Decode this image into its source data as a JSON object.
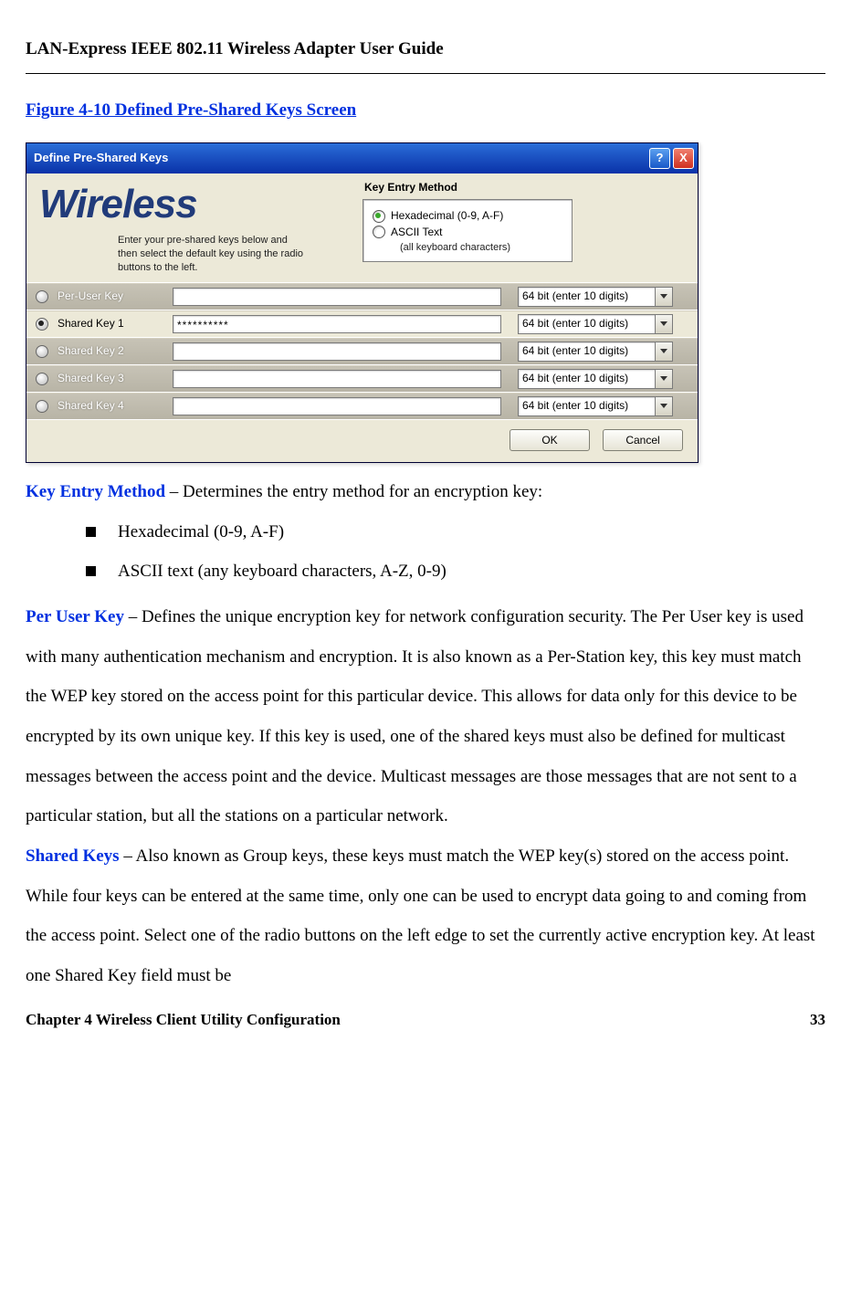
{
  "doc": {
    "header_title": "LAN-Express IEEE 802.11 Wireless Adapter User Guide",
    "figure_caption": "Figure 4-10 Defined Pre-Shared Keys Screen",
    "kem_term": "Key Entry Method",
    "kem_desc": " – Determines the entry method for an encryption key:",
    "bullet_hex": "Hexadecimal (0-9, A-F)",
    "bullet_ascii": "ASCII text (any keyboard characters, A-Z, 0-9)",
    "puk_term": "Per User Key",
    "puk_desc": " – Defines the unique encryption key for network configuration security. The Per User key is used with many authentication mechanism and encryption. It is also known as a Per-Station key, this key must match the WEP key stored on the access point for this particular device.  This allows for data only for this device to be encrypted by its own unique key.  If this key is used, one of the shared keys must also be defined for multicast messages between the access point and the device.  Multicast messages are those messages that are not sent to a particular station, but all the stations on a particular network.",
    "sk_term": "Shared Keys",
    "sk_desc": " – Also known as Group keys, these keys must match the WEP key(s) stored on the access point. While four keys can be entered at the same time, only one can be used to encrypt data going to and coming from the access point. Select one of the radio buttons on the left edge to set the currently active encryption key. At least one Shared Key field must be",
    "footer_left": "Chapter 4 Wireless Client Utility Configuration",
    "footer_right": "33"
  },
  "dialog": {
    "title": "Define Pre-Shared Keys",
    "help_glyph": "?",
    "close_glyph": "X",
    "brand": "Wireless",
    "instructions": "Enter your pre-shared keys below and then select the default key using the radio buttons to the left.",
    "kem_heading": "Key Entry Method",
    "radio_hex": "Hexadecimal (0-9, A-F)",
    "radio_ascii": "ASCII Text",
    "radio_ascii_sub": "(all keyboard characters)",
    "rows": {
      "r0": {
        "label": "Per-User Key",
        "value": "",
        "size": "64 bit (enter 10 digits)"
      },
      "r1": {
        "label": "Shared Key 1",
        "value": "**********",
        "size": "64 bit (enter 10 digits)"
      },
      "r2": {
        "label": "Shared Key 2",
        "value": "",
        "size": "64 bit (enter 10 digits)"
      },
      "r3": {
        "label": "Shared Key 3",
        "value": "",
        "size": "64 bit (enter 10 digits)"
      },
      "r4": {
        "label": "Shared Key 4",
        "value": "",
        "size": "64 bit (enter 10 digits)"
      }
    },
    "ok": "OK",
    "cancel": "Cancel"
  }
}
